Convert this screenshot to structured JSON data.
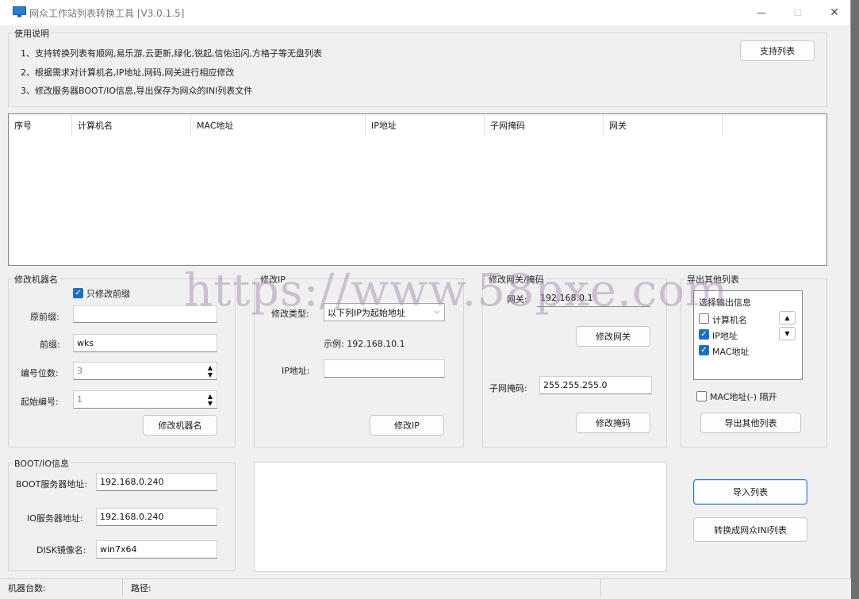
{
  "window": {
    "title": "网众工作站列表转换工具 [V3.0.1.5]",
    "minimize_glyph": "—",
    "maximize_glyph": "☐",
    "close_glyph": "✕"
  },
  "instructions": {
    "group_label": "使用说明",
    "line1": "1、支持转换列表有顺网,易乐游,云更新,绿化,锐起,信佑迅闪,方格子等无盘列表",
    "line2": "2、根据需求对计算机名,IP地址,网码,网关进行相应修改",
    "line3": "3、修改服务器BOOT/IO信息,导出保存为网众的INI列表文件",
    "support_button": "支持列表"
  },
  "table": {
    "columns": [
      "序号",
      "计算机名",
      "MAC地址",
      "IP地址",
      "子网掩码",
      "网关"
    ],
    "rows": []
  },
  "rename": {
    "group_label": "修改机器名",
    "only_prefix_label": "只修改前缀",
    "only_prefix_checked": true,
    "orig_prefix_label": "原前缀:",
    "orig_prefix_value": "",
    "prefix_label": "前缀:",
    "prefix_value": "wks",
    "digits_label": "编号位数:",
    "digits_value": "3",
    "start_label": "起始编号:",
    "start_value": "1",
    "button": "修改机器名"
  },
  "ip": {
    "group_label": "修改IP",
    "type_label": "修改类型:",
    "type_value": "以下列IP为起始地址",
    "example": "示例: 192.168.10.1",
    "ip_label": "IP地址:",
    "ip_value": "",
    "button": "修改IP"
  },
  "gateway": {
    "group_label": "修改网关/掩码",
    "gateway_label": "网关:",
    "gateway_value": "192.168.0.1",
    "gateway_button": "修改网关",
    "mask_label": "子网掩码:",
    "mask_value": "255.255.255.0",
    "mask_button": "修改掩码"
  },
  "export": {
    "group_label": "导出其他列表",
    "list_header": "选择输出信息",
    "options": [
      {
        "label": "计算机名",
        "checked": false
      },
      {
        "label": "IP地址",
        "checked": true
      },
      {
        "label": "MAC地址",
        "checked": true
      }
    ],
    "mac_sep_label": "MAC地址(-) 隔开",
    "mac_sep_checked": false,
    "button": "导出其他列表"
  },
  "bootio": {
    "group_label": "BOOT/IO信息",
    "boot_label": "BOOT服务器地址:",
    "boot_value": "192.168.0.240",
    "io_label": "IO服务器地址:",
    "io_value": "192.168.0.240",
    "disk_label": "DISK镜像名:",
    "disk_value": "win7x64"
  },
  "actions": {
    "import_button": "导入列表",
    "convert_button": "转换成网众INI列表"
  },
  "status": {
    "count_label": "机器台数:",
    "path_label": "路径:"
  },
  "watermark": "https://www.58pxe.com",
  "colors": {
    "accent": "#1f6fc5",
    "window_bg": "#f0f0f0"
  }
}
